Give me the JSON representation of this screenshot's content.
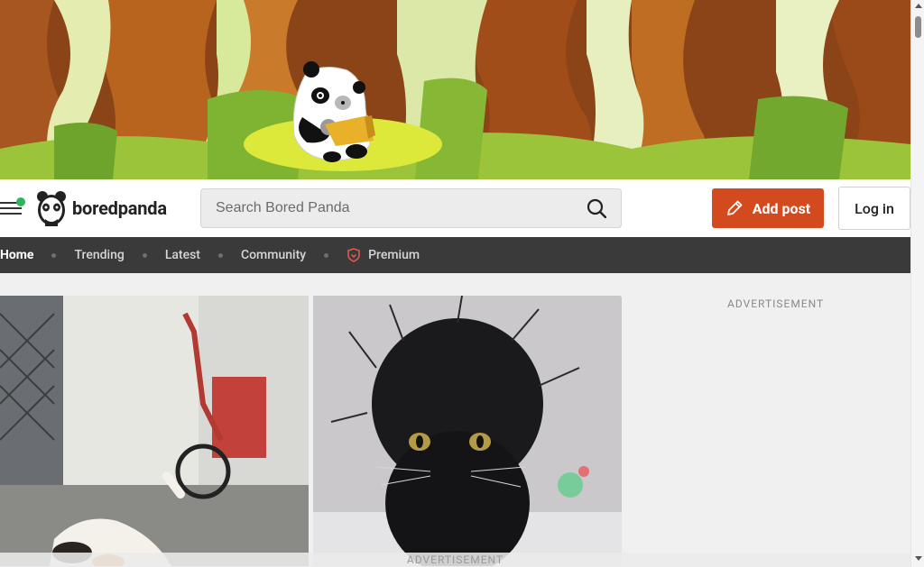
{
  "header": {
    "logo_text": "boredpanda",
    "search_placeholder": "Search Bored Panda",
    "add_post_label": "Add post",
    "login_label": "Log in"
  },
  "nav": {
    "items": [
      {
        "label": "Home"
      },
      {
        "label": "Trending"
      },
      {
        "label": "Latest"
      },
      {
        "label": "Community"
      },
      {
        "label": "Premium"
      }
    ]
  },
  "sidebar": {
    "ad_label": "ADVERTISEMENT"
  },
  "footer_ad": {
    "label": "ADVERTISEMENT"
  },
  "colors": {
    "accent": "#d34a1f",
    "nav_background": "#3a3a3a",
    "online_dot": "#2db55d"
  },
  "icons": [
    "hamburger-icon",
    "panda-logo-icon",
    "search-icon",
    "pencil-icon",
    "premium-shield-icon"
  ]
}
